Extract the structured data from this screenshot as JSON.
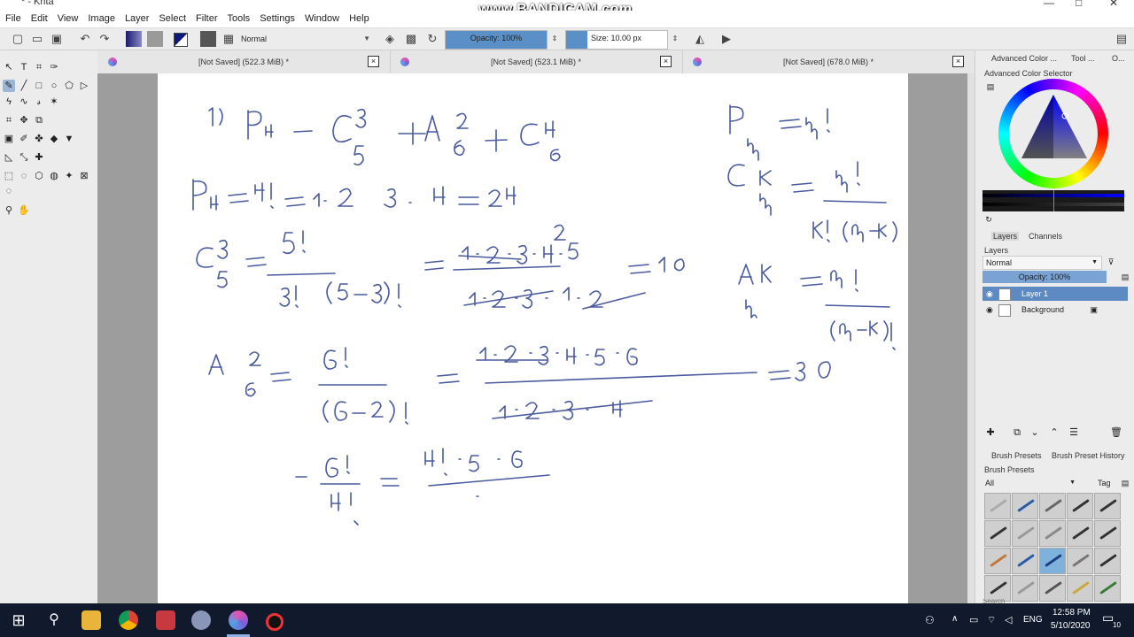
{
  "window": {
    "title": "* - Krita",
    "controls": [
      "—",
      "□",
      "✕"
    ]
  },
  "watermark": "www.BANDICAM.com",
  "menu": [
    "File",
    "Edit",
    "View",
    "Image",
    "Layer",
    "Select",
    "Filter",
    "Tools",
    "Settings",
    "Window",
    "Help"
  ],
  "toolbar": {
    "blend_mode": "Normal",
    "opacity_label": "Opacity: 100%",
    "size_label": "Size: 10.00 px",
    "opacity_value": 1.0
  },
  "tabs": [
    {
      "label": "[Not Saved]  (522.3 MiB) *"
    },
    {
      "label": "[Not Saved]  (523.1 MiB) *"
    },
    {
      "label": "[Not Saved]  (678.0 MiB) *"
    }
  ],
  "dock": {
    "top_tabs": [
      "Advanced Color ...",
      "Tool ...",
      "O..."
    ],
    "color_selector_title": "Advanced Color Selector",
    "layer_tabs": [
      "Layers",
      "Channels"
    ],
    "layers_title": "Layers",
    "layer_blend": "Normal",
    "layer_opacity": "Opacity:  100%",
    "layers": [
      {
        "name": "Layer 1",
        "selected": true
      },
      {
        "name": "Background",
        "selected": false
      }
    ],
    "brush_tabs": [
      "Brush Presets",
      "Brush Preset History"
    ],
    "brush_title": "Brush Presets",
    "brush_filter": "All",
    "brush_tag": "Tag",
    "search_placeholder": "Search"
  },
  "taskbar": {
    "language": "ENG",
    "time": "12:58 PM",
    "date": "5/10/2020",
    "notification_count": "10"
  },
  "colors": {
    "accent": "#5e8ac4",
    "ink": "#3a4a9c",
    "taskbar": "#101a2c"
  }
}
